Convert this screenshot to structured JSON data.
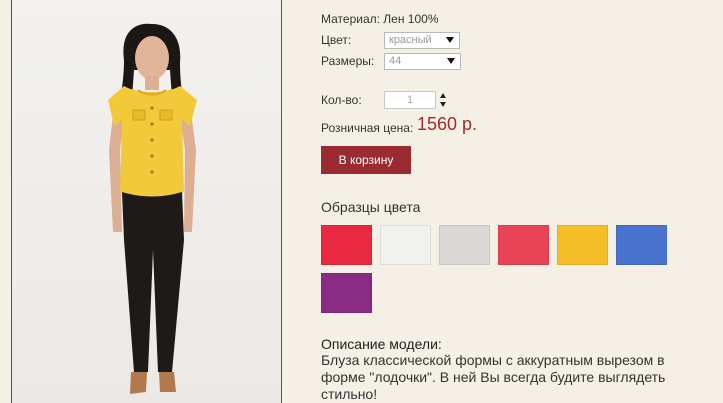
{
  "product": {
    "material": "Материал: Лен 100%",
    "color_label": "Цвет:",
    "color_value": "красный",
    "size_label": "Размеры:",
    "size_value": "44",
    "qty_label": "Кол-во:",
    "qty_value": "1",
    "price_label": "Розничная цена:",
    "price_value": "1560 р.",
    "cart_button": "В корзину"
  },
  "swatches": {
    "title": "Образцы цвета",
    "colors": [
      "#e8293f",
      "#f1f1f0",
      "#d9d8d4",
      "#e84456",
      "#f6bf2a",
      "#4a73cf",
      "#8a2b84"
    ]
  },
  "description": {
    "title": "Описание модели:",
    "text": "Блуза классической формы с аккуратным вырезом в форме \"лодочки\". В ней Вы всегда будите выглядеть стильно!"
  }
}
